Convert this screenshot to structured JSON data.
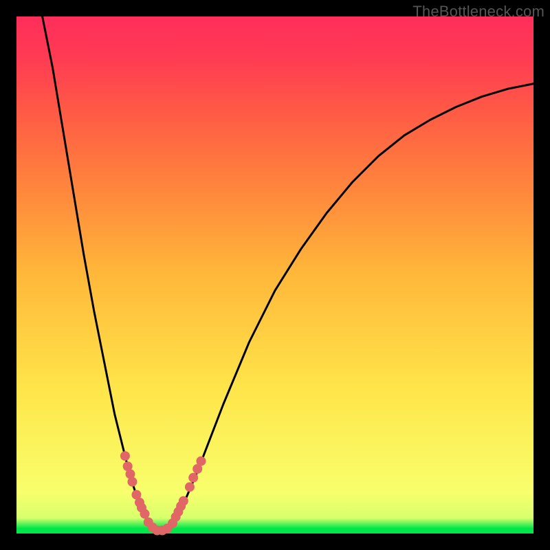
{
  "watermark": "TheBottleneck.com",
  "colors": {
    "frame": "#000000",
    "curve": "#000000",
    "markers": "#e16666",
    "gradient_top": "#ff2e5b",
    "gradient_bottom": "#00e74a"
  },
  "chart_data": {
    "type": "line",
    "title": "",
    "xlabel": "",
    "ylabel": "",
    "xlim": [
      0,
      100
    ],
    "ylim": [
      0,
      100
    ],
    "series": [
      {
        "name": "left-branch",
        "x": [
          5,
          7,
          9,
          11,
          13,
          15,
          17,
          19,
          21,
          22,
          23,
          24,
          25
        ],
        "y": [
          100,
          90,
          78,
          66,
          54,
          43,
          33,
          23,
          15,
          11,
          8,
          5,
          3
        ]
      },
      {
        "name": "valley-floor",
        "x": [
          25,
          26,
          27,
          28,
          29,
          30
        ],
        "y": [
          3,
          1,
          0.5,
          0.5,
          0.7,
          1.5
        ]
      },
      {
        "name": "right-branch",
        "x": [
          30,
          32,
          35,
          40,
          45,
          50,
          55,
          60,
          65,
          70,
          75,
          80,
          85,
          90,
          95,
          100
        ],
        "y": [
          1.5,
          5,
          12,
          25,
          37,
          47,
          55,
          62,
          68,
          73,
          77,
          80,
          82.5,
          84.5,
          86,
          87
        ]
      }
    ],
    "marker_clusters": [
      {
        "name": "left-cluster-upper",
        "points": [
          {
            "x": 21.0,
            "y": 15.0
          },
          {
            "x": 21.5,
            "y": 13.0
          },
          {
            "x": 22.0,
            "y": 11.5
          },
          {
            "x": 22.4,
            "y": 10.0
          }
        ]
      },
      {
        "name": "left-cluster-lower",
        "points": [
          {
            "x": 23.2,
            "y": 7.5
          },
          {
            "x": 23.8,
            "y": 6.0
          },
          {
            "x": 24.2,
            "y": 5.0
          },
          {
            "x": 24.8,
            "y": 3.8
          }
        ]
      },
      {
        "name": "bottom-cluster",
        "points": [
          {
            "x": 25.5,
            "y": 2.2
          },
          {
            "x": 26.3,
            "y": 1.2
          },
          {
            "x": 27.2,
            "y": 0.6
          },
          {
            "x": 28.2,
            "y": 0.6
          },
          {
            "x": 29.2,
            "y": 1.0
          }
        ]
      },
      {
        "name": "right-cluster-lower",
        "points": [
          {
            "x": 30.2,
            "y": 2.0
          },
          {
            "x": 30.8,
            "y": 3.2
          },
          {
            "x": 31.3,
            "y": 4.2
          },
          {
            "x": 31.8,
            "y": 5.3
          },
          {
            "x": 32.3,
            "y": 6.3
          }
        ]
      },
      {
        "name": "right-cluster-upper",
        "points": [
          {
            "x": 33.5,
            "y": 9.0
          },
          {
            "x": 34.2,
            "y": 10.8
          },
          {
            "x": 35.0,
            "y": 12.5
          },
          {
            "x": 35.7,
            "y": 14.0
          }
        ]
      }
    ]
  }
}
